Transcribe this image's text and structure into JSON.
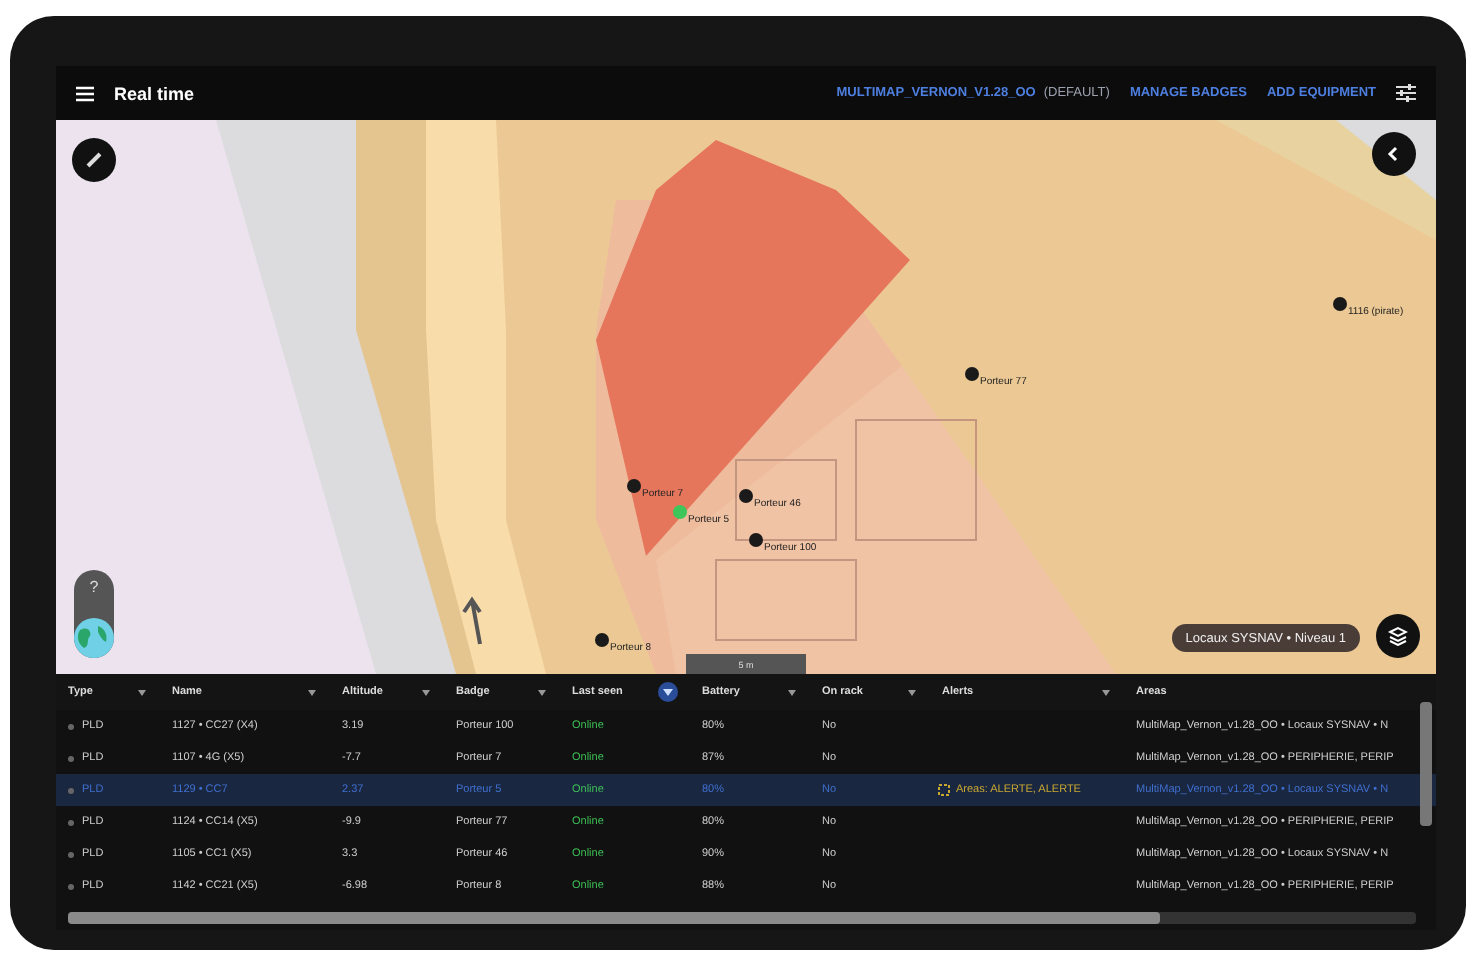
{
  "top_bar": {
    "title": "Real time",
    "links": [
      "MULTIMAP_VERNON_V1.28_OO",
      "MANAGE BADGES",
      "ADD EQUIPMENT"
    ],
    "map_suffix": "(DEFAULT)"
  },
  "map": {
    "markers": [
      {
        "label": "1116 (pirate)",
        "color": "#1a1a1a"
      },
      {
        "label": "Porteur 77",
        "color": "#1a1a1a"
      },
      {
        "label": "Porteur 7",
        "color": "#1a1a1a"
      },
      {
        "label": "Porteur 5",
        "color": "#3fc65a"
      },
      {
        "label": "Porteur 46",
        "color": "#1a1a1a"
      },
      {
        "label": "Porteur 100",
        "color": "#1a1a1a"
      },
      {
        "label": "Porteur 8",
        "color": "#1a1a1a"
      }
    ],
    "help": "?",
    "scale": "5 m",
    "level_chip": "Locaux SYSNAV • Niveau 1"
  },
  "table": {
    "columns": [
      {
        "label": "Type",
        "filter_active": false
      },
      {
        "label": "Name",
        "filter_active": false
      },
      {
        "label": "Altitude",
        "filter_active": false
      },
      {
        "label": "Badge",
        "filter_active": false
      },
      {
        "label": "Last seen",
        "filter_active": true
      },
      {
        "label": "Battery",
        "filter_active": false
      },
      {
        "label": "On rack",
        "filter_active": false
      },
      {
        "label": "Alerts",
        "filter_active": false
      },
      {
        "label": "Areas"
      }
    ],
    "rows": [
      {
        "selected": false,
        "type": "PLD",
        "name": "1127 • CC27 (X4)",
        "altitude": "3.19",
        "badge": "Porteur 100",
        "last_seen": "Online",
        "battery": "80%",
        "on_rack": "No",
        "areas": "MultiMap_Vernon_v1.28_OO • Locaux SYSNAV • N"
      },
      {
        "selected": false,
        "type": "PLD",
        "name": "1107 • 4G (X5)",
        "altitude": "-7.7",
        "badge": "Porteur 7",
        "last_seen": "Online",
        "battery": "87%",
        "on_rack": "No",
        "areas": "MultiMap_Vernon_v1.28_OO • PERIPHERIE, PERIP"
      },
      {
        "selected": true,
        "type": "PLD",
        "name": "1129 • CC7",
        "altitude": "2.37",
        "badge": "Porteur 5",
        "last_seen": "Online",
        "battery": "80%",
        "on_rack": "No",
        "alert": "Areas: ALERTE, ALERTE",
        "areas": "MultiMap_Vernon_v1.28_OO • Locaux SYSNAV • N"
      },
      {
        "selected": false,
        "type": "PLD",
        "name": "1124 • CC14 (X5)",
        "altitude": "-9.9",
        "badge": "Porteur 77",
        "last_seen": "Online",
        "battery": "80%",
        "on_rack": "No",
        "areas": "MultiMap_Vernon_v1.28_OO • PERIPHERIE, PERIP"
      },
      {
        "selected": false,
        "type": "PLD",
        "name": "1105 • CC1 (X5)",
        "altitude": "3.3",
        "badge": "Porteur 46",
        "last_seen": "Online",
        "battery": "90%",
        "on_rack": "No",
        "areas": "MultiMap_Vernon_v1.28_OO • Locaux SYSNAV • N"
      },
      {
        "selected": false,
        "type": "PLD",
        "name": "1142 • CC21 (X5)",
        "altitude": "-6.98",
        "badge": "Porteur 8",
        "last_seen": "Online",
        "battery": "88%",
        "on_rack": "No",
        "areas": "MultiMap_Vernon_v1.28_OO • PERIPHERIE, PERIP"
      }
    ]
  }
}
